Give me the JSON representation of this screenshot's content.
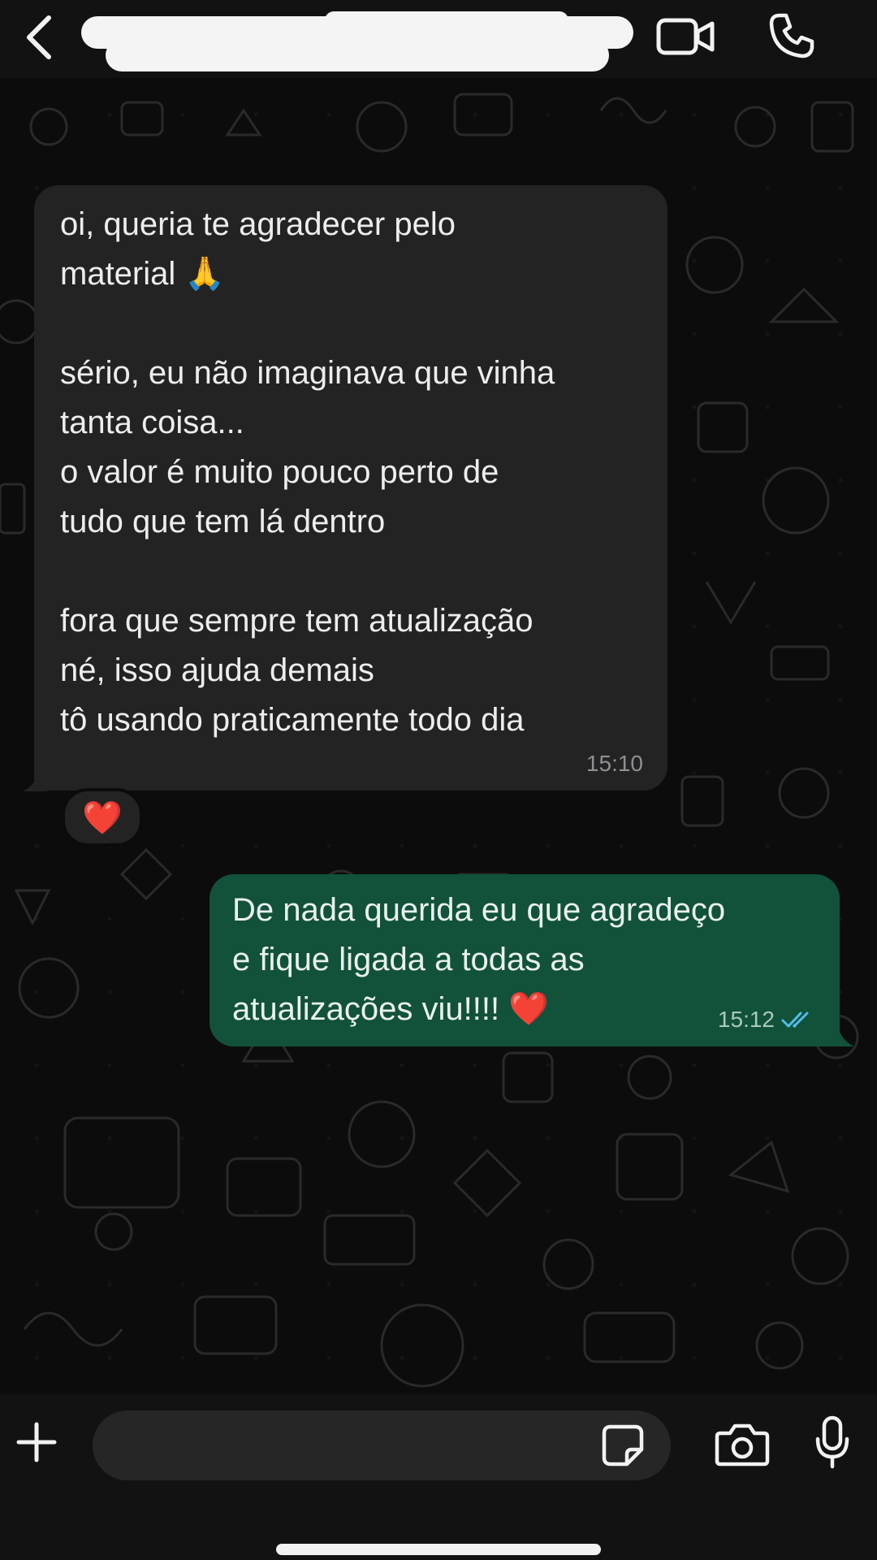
{
  "header": {
    "back_icon": "chevron-left-icon",
    "contact_name": "",
    "video_icon": "video-camera-icon",
    "call_icon": "phone-icon"
  },
  "messages": [
    {
      "direction": "incoming",
      "lines": [
        "oi, queria te agradecer pelo",
        "material 🙏",
        "",
        "sério, eu não imaginava que vinha",
        "tanta coisa...",
        "o valor é muito pouco perto de",
        "tudo que tem lá dentro",
        "",
        "fora que sempre tem atualização",
        "né, isso ajuda demais",
        "tô usando praticamente todo dia"
      ],
      "time": "15:10",
      "reaction": "❤️"
    },
    {
      "direction": "outgoing",
      "lines": [
        "De nada querida eu que agradeço",
        "e fique ligada a todas as",
        "atualizações viu!!!! ❤️"
      ],
      "time": "15:12",
      "status_icon": "double-check-read-icon"
    }
  ],
  "composer": {
    "plus_icon": "plus-icon",
    "input_value": "",
    "sticker_icon": "sticker-icon",
    "camera_icon": "camera-icon",
    "mic_icon": "microphone-icon"
  },
  "colors": {
    "incoming_bubble": "#232323",
    "outgoing_bubble": "#12513a",
    "read_ticks": "#53bdeb",
    "background": "#0b0b0b"
  }
}
